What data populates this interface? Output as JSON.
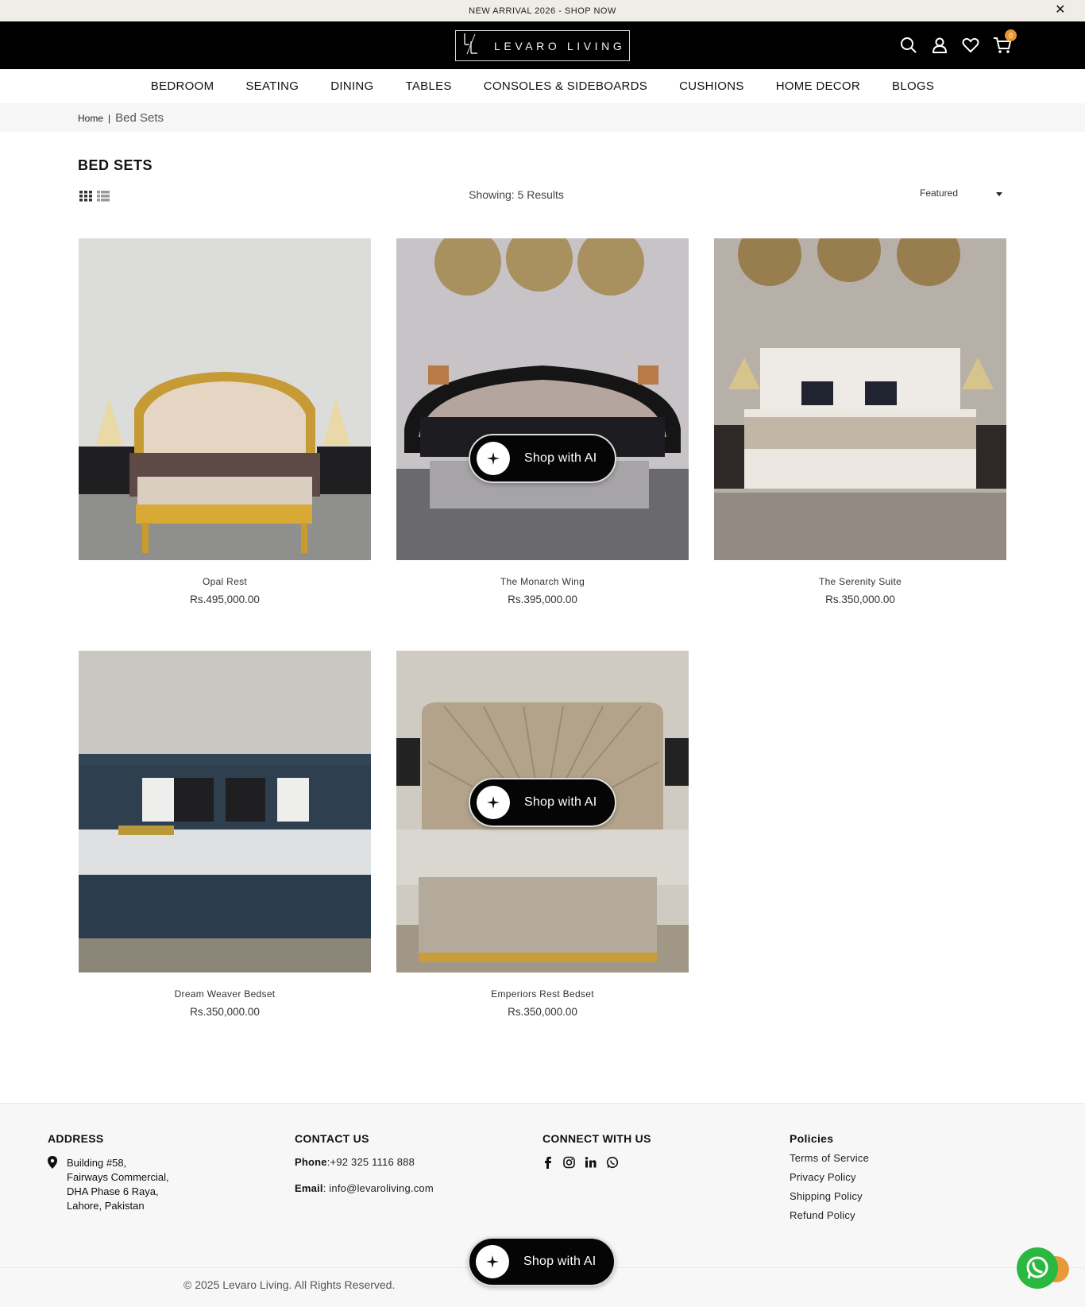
{
  "announcement": {
    "text": "NEW ARRIVAL 2026 - SHOP NOW",
    "close_icon": "close-icon"
  },
  "header": {
    "logo_mark": "L",
    "logo_text": "LEVARO LIVING",
    "cart_count": "0",
    "icons": [
      "search-icon",
      "user-icon",
      "heart-icon",
      "cart-icon"
    ]
  },
  "nav": {
    "items": [
      "BEDROOM",
      "SEATING",
      "DINING",
      "TABLES",
      "CONSOLES & SIDEBOARDS",
      "CUSHIONS",
      "HOME DECOR",
      "BLOGS"
    ]
  },
  "breadcrumb": {
    "home": "Home",
    "separator": "|",
    "current": "Bed Sets"
  },
  "collection": {
    "title": "BED SETS",
    "results": "Showing: 5 Results",
    "sort_selected": "Featured"
  },
  "products": [
    {
      "name": "Opal Rest",
      "price": "Rs.495,000.00"
    },
    {
      "name": "The Monarch Wing",
      "price": "Rs.395,000.00"
    },
    {
      "name": "The Serenity Suite",
      "price": "Rs.350,000.00"
    },
    {
      "name": "Dream Weaver Bedset",
      "price": "Rs.350,000.00"
    },
    {
      "name": "Emperiors Rest Bedset",
      "price": "Rs.350,000.00"
    }
  ],
  "ai_button": {
    "label": "Shop with AI"
  },
  "footer": {
    "address": {
      "heading": "ADDRESS",
      "lines": [
        "Building #58,",
        "Fairways Commercial,",
        "DHA Phase 6 Raya,",
        "Lahore, Pakistan"
      ]
    },
    "contact": {
      "heading": "CONTACT US",
      "phone_label": "Phone",
      "phone": ":+92 325 1116 888",
      "email_label": "Email",
      "email": ": info@levaroliving.com"
    },
    "connect": {
      "heading": "CONNECT WITH US",
      "icons": [
        "facebook-icon",
        "instagram-icon",
        "linkedin-icon",
        "whatsapp-icon"
      ]
    },
    "policies": {
      "heading": "Policies",
      "links": [
        "Terms of Service",
        "Privacy Policy",
        "Shipping Policy",
        "Refund Policy"
      ]
    },
    "copyright": "© 2025 Levaro Living. All Rights Reserved."
  },
  "colors": {
    "header_bg": "#000000",
    "announce_bg": "#f0ece6",
    "cart_badge": "#e6952d",
    "whatsapp": "#2ab840"
  }
}
